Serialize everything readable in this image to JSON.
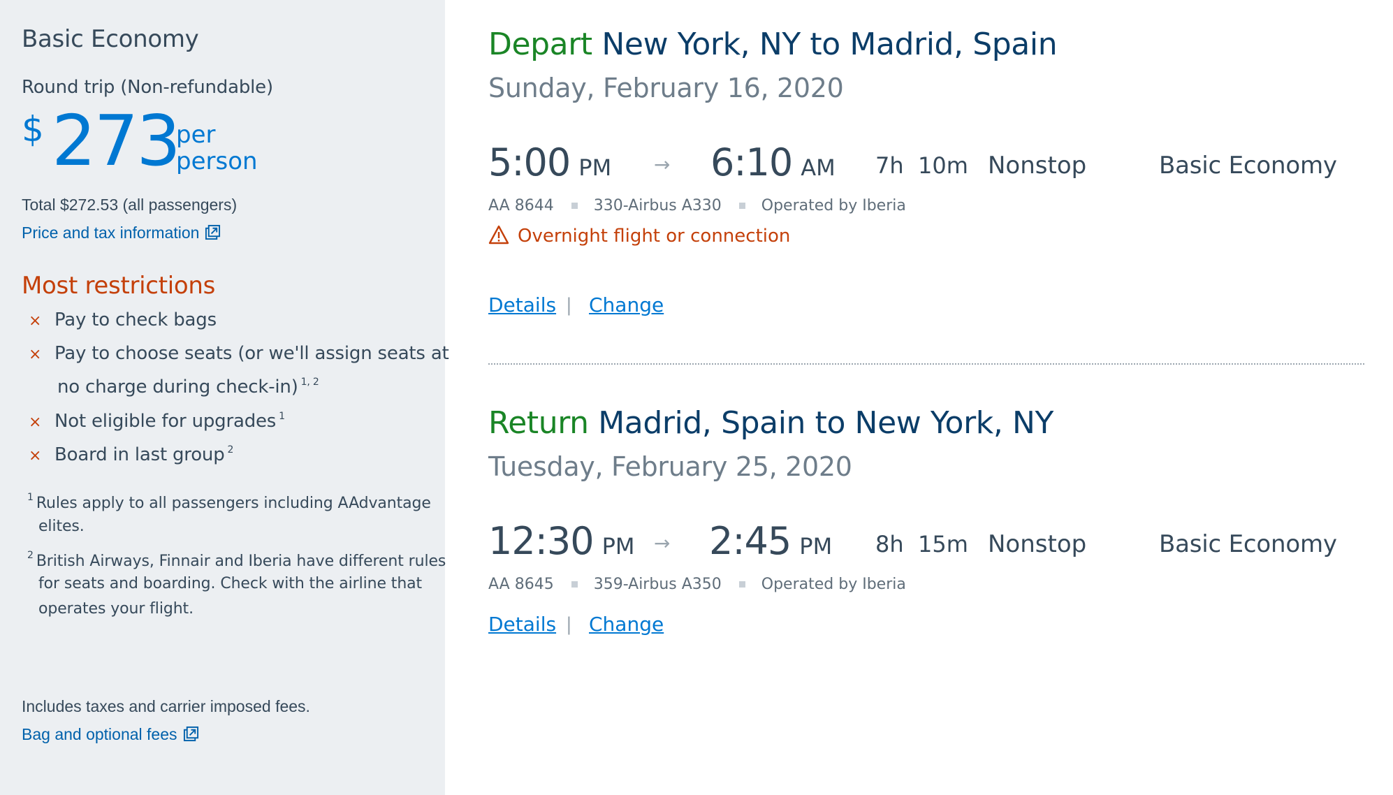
{
  "sidebar": {
    "fare_title": "Basic Economy",
    "trip_type": "Round trip (Non-refundable)",
    "currency_symbol": "$",
    "price": "273",
    "per_label": "per",
    "person_label": "person",
    "total": "Total $272.53 (all passengers)",
    "price_tax_link": "Price and tax information",
    "restrictions_heading": "Most restrictions",
    "restriction_mark": "×",
    "restrictions": [
      {
        "text": "Pay to check bags",
        "sup": ""
      },
      {
        "text": "Pay to choose seats (or we'll assign seats at",
        "continuation": "no charge during check-in)",
        "sup": "1, 2"
      },
      {
        "text": "Not eligible for upgrades",
        "sup": "1"
      },
      {
        "text": "Board in last group",
        "sup": "2"
      }
    ],
    "footnotes": [
      {
        "num": "1",
        "lines": [
          "Rules apply to all passengers including AAdvantage",
          "elites."
        ]
      },
      {
        "num": "2",
        "lines": [
          "British Airways, Finnair and Iberia have different rules",
          "for seats and boarding. Check with the airline that",
          "operates your flight."
        ]
      }
    ],
    "includes_text": "Includes taxes and carrier imposed fees.",
    "bag_fees_link": "Bag and optional fees"
  },
  "flights": [
    {
      "direction": "Depart",
      "route": "New York, NY to Madrid, Spain",
      "date": "Sunday, February 16, 2020",
      "depart_time": "5:00",
      "depart_ampm": "PM",
      "arrive_time": "6:10",
      "arrive_ampm": "AM",
      "duration_h": "7h",
      "duration_m": "10m",
      "stops": "Nonstop",
      "cabin": "Basic Economy",
      "flight_number": "AA 8644",
      "aircraft": "330-Airbus A330",
      "operator": "Operated by Iberia",
      "warning": "Overnight flight or connection",
      "details_label": "Details",
      "change_label": "Change"
    },
    {
      "direction": "Return",
      "route": "Madrid, Spain to New York, NY",
      "date": "Tuesday, February 25, 2020",
      "depart_time": "12:30",
      "depart_ampm": "PM",
      "arrive_time": "2:45",
      "arrive_ampm": "PM",
      "duration_h": "8h",
      "duration_m": "15m",
      "stops": "Nonstop",
      "cabin": "Basic Economy",
      "flight_number": "AA 8645",
      "aircraft": "359-Airbus A350",
      "operator": "Operated by Iberia",
      "details_label": "Details",
      "change_label": "Change"
    }
  ],
  "ui": {
    "arrow_glyph": "→",
    "pipe_glyph": "|",
    "colors": {
      "brand_blue": "#0078d2",
      "heading_navy": "#0b3d68",
      "direction_green": "#1a8526",
      "restriction_red": "#c4400a",
      "sidebar_bg": "#eceff2"
    }
  }
}
